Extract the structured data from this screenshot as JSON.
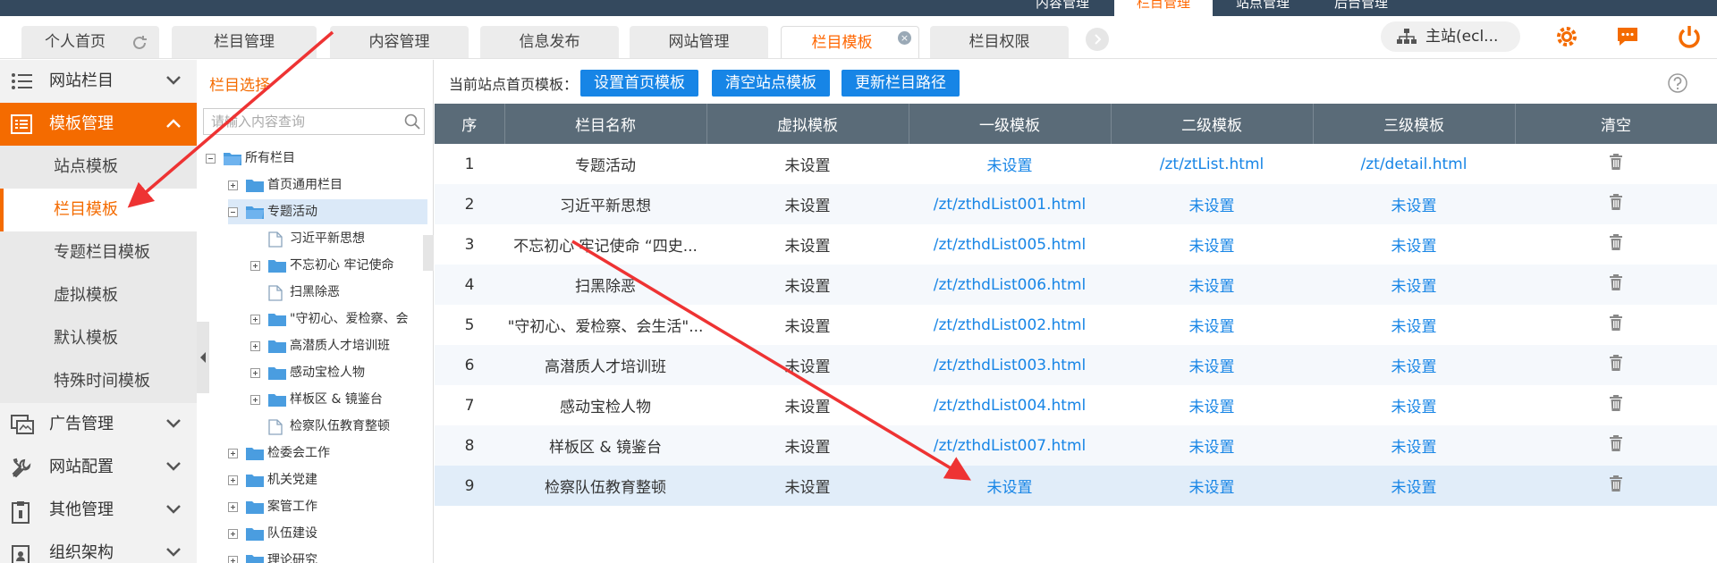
{
  "top_nav": {
    "items": [
      "内容管理",
      "栏目管理",
      "站点管理",
      "后台管理"
    ],
    "active": "栏目管理"
  },
  "tabs": [
    {
      "label": "个人首页",
      "has_reload": true
    },
    {
      "label": "栏目管理"
    },
    {
      "label": "内容管理"
    },
    {
      "label": "信息发布"
    },
    {
      "label": "网站管理"
    },
    {
      "label": "栏目模板",
      "active": true,
      "closable": true
    },
    {
      "label": "栏目权限"
    }
  ],
  "header": {
    "site_label": "主站(ecl...",
    "icons": [
      "gear-icon",
      "message-icon",
      "power-icon"
    ]
  },
  "sidebar": {
    "groups": [
      {
        "label": "网站栏目",
        "icon": "list-icon"
      },
      {
        "label": "模板管理",
        "icon": "template-icon",
        "open": true
      },
      {
        "label": "广告管理",
        "icon": "ad-icon"
      },
      {
        "label": "网站配置",
        "icon": "tools-icon"
      },
      {
        "label": "其他管理",
        "icon": "clipboard-icon"
      },
      {
        "label": "组织架构",
        "icon": "org-icon"
      }
    ],
    "sub_items": [
      "站点模板",
      "栏目模板",
      "专题栏目模板",
      "虚拟模板",
      "默认模板",
      "特殊时间模板"
    ],
    "active_sub": "栏目模板"
  },
  "tree": {
    "title": "栏目选择",
    "search_placeholder": "请输入内容查询",
    "nodes": [
      "所有栏目",
      "首页通用栏目",
      "专题活动",
      "习近平新思想",
      "不忘初心 牢记使命",
      "扫黑除恶",
      "\"守初心、爱检察、会",
      "高潜质人才培训班",
      "感动宝检人物",
      "样板区 & 镜鉴台",
      "检察队伍教育整顿",
      "检委会工作",
      "机关党建",
      "案管工作",
      "队伍建设",
      "理论研究"
    ],
    "selected": "专题活动"
  },
  "toolbar": {
    "label": "当前站点首页模板：",
    "buttons": [
      "设置首页模板",
      "清空站点模板",
      "更新栏目路径"
    ]
  },
  "grid": {
    "columns": [
      "序",
      "栏目名称",
      "虚拟模板",
      "一级模板",
      "二级模板",
      "三级模板",
      "清空"
    ],
    "rows": [
      [
        "1",
        "专题活动",
        "未设置",
        "未设置",
        "/zt/ztList.html",
        "/zt/detail.html"
      ],
      [
        "2",
        "习近平新思想",
        "未设置",
        "/zt/zthdList001.html",
        "未设置",
        "未设置"
      ],
      [
        "3",
        "不忘初心 牢记使命 “四史...",
        "未设置",
        "/zt/zthdList005.html",
        "未设置",
        "未设置"
      ],
      [
        "4",
        "扫黑除恶",
        "未设置",
        "/zt/zthdList006.html",
        "未设置",
        "未设置"
      ],
      [
        "5",
        "\"守初心、爱检察、会生活\"...",
        "未设置",
        "/zt/zthdList002.html",
        "未设置",
        "未设置"
      ],
      [
        "6",
        "高潜质人才培训班",
        "未设置",
        "/zt/zthdList003.html",
        "未设置",
        "未设置"
      ],
      [
        "7",
        "感动宝检人物",
        "未设置",
        "/zt/zthdList004.html",
        "未设置",
        "未设置"
      ],
      [
        "8",
        "样板区 & 镜鉴台",
        "未设置",
        "/zt/zthdList007.html",
        "未设置",
        "未设置"
      ],
      [
        "9",
        "检察队伍教育整顿",
        "未设置",
        "未设置",
        "未设置",
        "未设置"
      ]
    ],
    "highlighted_row": 9
  },
  "colors": {
    "accent": "#f46b00",
    "primary": "#1785e6",
    "header": "#5a6b78",
    "annotation": "#ee3333"
  }
}
